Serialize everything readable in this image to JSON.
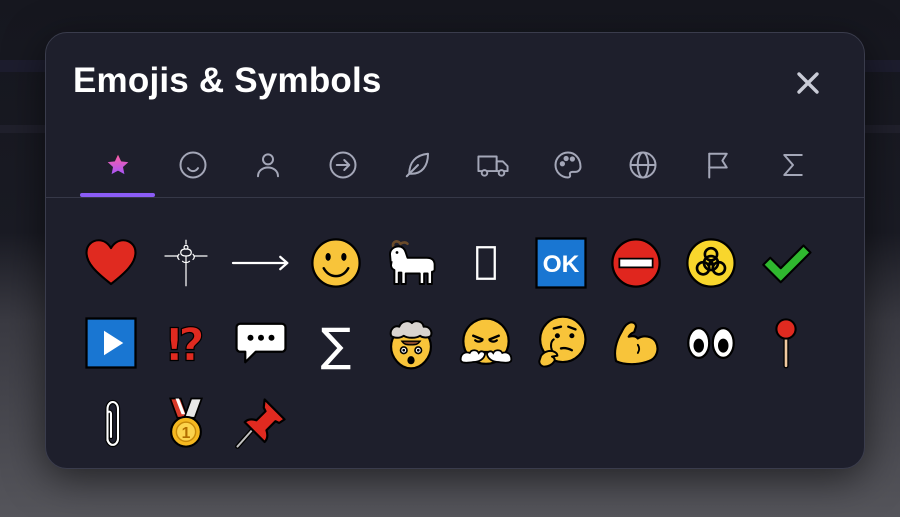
{
  "dialog": {
    "title": "Emojis & Symbols",
    "close_icon": "close-icon"
  },
  "tabs": [
    {
      "icon": "star-icon",
      "active": true
    },
    {
      "icon": "smiley-icon",
      "active": false
    },
    {
      "icon": "person-icon",
      "active": false
    },
    {
      "icon": "arrow-circle-icon",
      "active": false
    },
    {
      "icon": "leaf-icon",
      "active": false
    },
    {
      "icon": "truck-icon",
      "active": false
    },
    {
      "icon": "palette-icon",
      "active": false
    },
    {
      "icon": "globe-icon",
      "active": false
    },
    {
      "icon": "flag-icon",
      "active": false
    },
    {
      "icon": "sigma-icon",
      "active": false
    }
  ],
  "emojis": [
    {
      "name": "red-heart"
    },
    {
      "name": "ornament-symbol"
    },
    {
      "name": "long-right-arrow"
    },
    {
      "name": "smiling-face"
    },
    {
      "name": "goat"
    },
    {
      "name": "empty-rectangle"
    },
    {
      "name": "ok-button",
      "text": "OK"
    },
    {
      "name": "no-entry"
    },
    {
      "name": "biohazard"
    },
    {
      "name": "check-mark"
    },
    {
      "name": "play-button"
    },
    {
      "name": "exclamation-question-mark",
      "text": "⁉"
    },
    {
      "name": "speech-bubble"
    },
    {
      "name": "summation",
      "text": "∑"
    },
    {
      "name": "exploding-head"
    },
    {
      "name": "face-with-steam"
    },
    {
      "name": "thinking-face"
    },
    {
      "name": "flexed-biceps"
    },
    {
      "name": "eyes"
    },
    {
      "name": "round-pushpin"
    },
    {
      "name": "paperclip"
    },
    {
      "name": "first-place-medal",
      "text": "1"
    },
    {
      "name": "pushpin"
    }
  ],
  "colors": {
    "accent": "#8b5cf6",
    "panel": "#1e1f2c",
    "icon_inactive": "#a4a7b8",
    "star_top": "#ff5fa2",
    "star_bottom": "#a855f7"
  }
}
